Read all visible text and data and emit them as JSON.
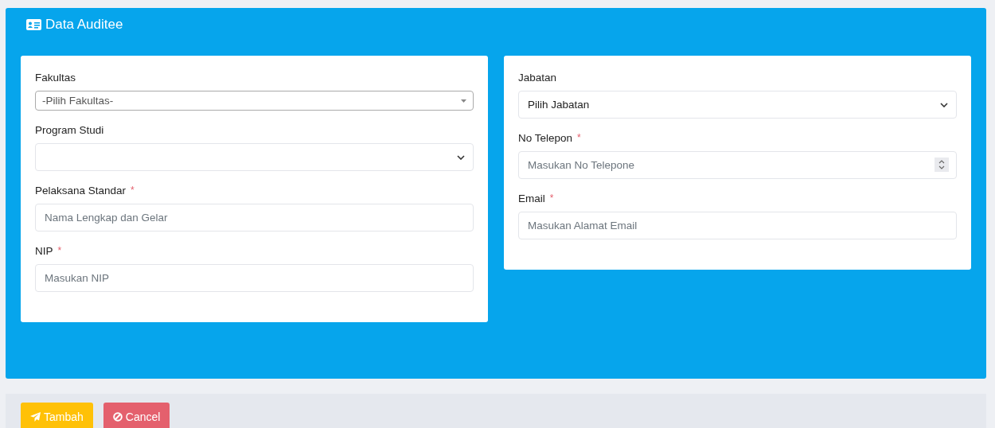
{
  "card": {
    "title": "Data Auditee"
  },
  "columns": [
    {
      "fields": [
        {
          "kind": "select2",
          "label": "Fakultas",
          "value": "-Pilih Fakultas-"
        },
        {
          "kind": "select",
          "label": "Program Studi"
        },
        {
          "kind": "text",
          "label": "Pelaksana Standar",
          "required_mark": "*",
          "placeholder": "Nama Lengkap dan Gelar"
        },
        {
          "kind": "text",
          "label": "NIP",
          "required_mark": "*",
          "placeholder": "Masukan NIP"
        }
      ]
    },
    {
      "fields": [
        {
          "kind": "select",
          "label": "Jabatan",
          "value": "Pilih Jabatan"
        },
        {
          "kind": "number",
          "label": "No Telepon",
          "required_mark": "*",
          "placeholder": "Masukan No Telepone"
        },
        {
          "kind": "text",
          "label": "Email",
          "required_mark": "*",
          "placeholder": "Masukan Alamat Email"
        }
      ]
    }
  ],
  "buttons": [
    {
      "kind": "submit",
      "label": "Tambah"
    },
    {
      "kind": "cancel",
      "label": "Cancel"
    }
  ]
}
